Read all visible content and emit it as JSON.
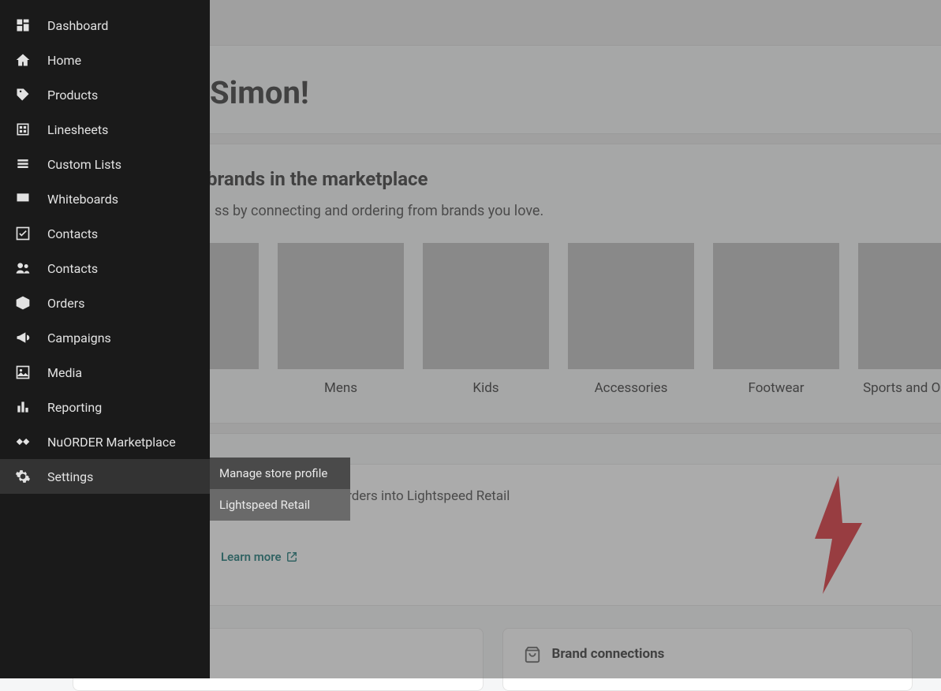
{
  "sidebar": {
    "items": [
      {
        "label": "Dashboard"
      },
      {
        "label": "Home"
      },
      {
        "label": "Products"
      },
      {
        "label": "Linesheets"
      },
      {
        "label": "Custom Lists"
      },
      {
        "label": "Whiteboards"
      },
      {
        "label": "Contacts"
      },
      {
        "label": "Contacts"
      },
      {
        "label": "Orders"
      },
      {
        "label": "Campaigns"
      },
      {
        "label": "Media"
      },
      {
        "label": "Reporting"
      },
      {
        "label": "NuORDER Marketplace"
      },
      {
        "label": "Settings"
      }
    ],
    "active_index": 13
  },
  "settings_flyout": {
    "items": [
      {
        "label": "Manage store profile"
      },
      {
        "label": "Lightspeed Retail"
      }
    ],
    "hover_index": 1
  },
  "greeting": "Simon!",
  "discover": {
    "heading": "brands in the marketplace",
    "subheading": "ss by connecting and ordering from brands you love.",
    "categories": [
      {
        "label": "",
        "thumb": "womens"
      },
      {
        "label": "Mens",
        "thumb": "mens"
      },
      {
        "label": "Kids",
        "thumb": "kids"
      },
      {
        "label": "Accessories",
        "thumb": "accessories"
      },
      {
        "label": "Footwear",
        "thumb": "footwear"
      },
      {
        "label": "Sports and Outdoor",
        "thumb": "sports"
      }
    ]
  },
  "promo": {
    "copy": "directly import your orders into Lightspeed Retail",
    "learn_more": "Learn more"
  },
  "cards": {
    "left_title": "",
    "right_title": "Brand connections"
  }
}
